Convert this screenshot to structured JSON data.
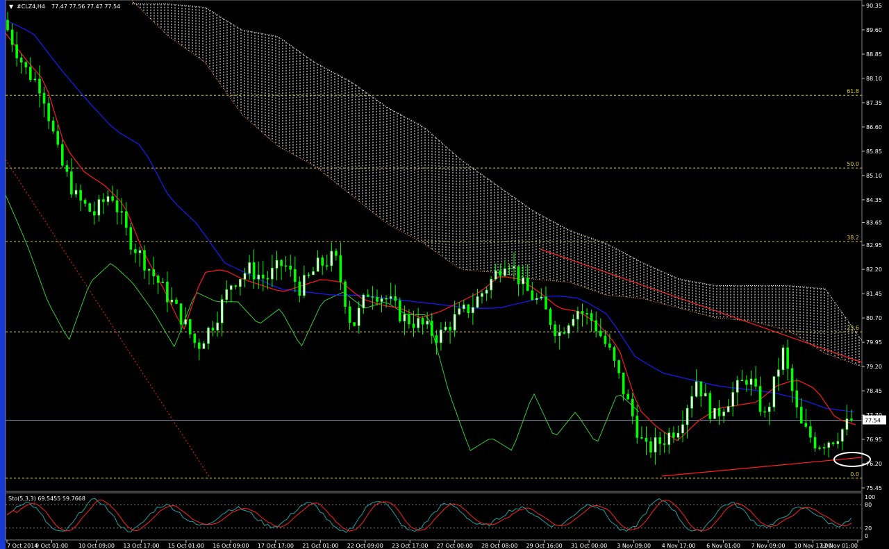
{
  "header": {
    "symbol": "#CLZ4,H4",
    "ohlc": "77.47 77.56 77.47 77.54"
  },
  "price_label": "77.54",
  "stochastic": {
    "label": "Sto(5,3,3) 69.5455 59.7668",
    "levels": [
      "100",
      "80",
      "20",
      "0"
    ]
  },
  "colors": {
    "background": "#000000",
    "bull_candle": "#ffffff",
    "bear_candle": "#00ff00",
    "tenkan": "#ff1a1a",
    "kijun": "#1a1aff",
    "chikou": "#33cc33",
    "cloud": "#ffffff",
    "fib": "#d8c830",
    "trendline": "#ff2020",
    "stoch_main": "#20a0a0",
    "stoch_signal": "#ff2020"
  },
  "chart_data": {
    "type": "candlestick",
    "symbol": "#CLZ4",
    "timeframe": "H4",
    "ylim": [
      75.45,
      90.35
    ],
    "y_ticks": [
      90.35,
      89.6,
      88.85,
      88.1,
      87.35,
      86.6,
      85.85,
      85.1,
      84.35,
      83.65,
      82.95,
      82.2,
      81.45,
      80.7,
      79.95,
      79.2,
      78.45,
      77.7,
      76.95,
      76.2,
      75.45
    ],
    "x_ticks": [
      "7 Oct 2014",
      "9 Oct 01:00",
      "10 Oct 09:00",
      "13 Oct 17:00",
      "15 Oct 01:00",
      "16 Oct 09:00",
      "17 Oct 17:00",
      "21 Oct 01:00",
      "22 Oct 09:00",
      "23 Oct 17:00",
      "27 Oct 00:00",
      "28 Oct 08:00",
      "29 Oct 16:00",
      "31 Oct 00:00",
      "3 Nov 09:00",
      "4 Nov 17:00",
      "6 Nov 01:00",
      "7 Nov 09:00",
      "10 Nov 17:00",
      "12 Nov 01:00"
    ],
    "fibonacci": [
      {
        "label": "61.8",
        "price": 87.58
      },
      {
        "label": "50.0",
        "price": 85.33
      },
      {
        "label": "38.2",
        "price": 83.06
      },
      {
        "label": "23.6",
        "price": 80.27
      },
      {
        "label": "0.0",
        "price": 75.75
      }
    ],
    "current_price": 77.54,
    "key_prices": [
      89.6,
      88.4,
      87.8,
      85.6,
      84.4,
      83.9,
      84.6,
      83.2,
      82.4,
      81.6,
      80.8,
      79.8,
      80.6,
      81.8,
      82.2,
      81.9,
      82.4,
      81.6,
      82.3,
      82.6,
      80.4,
      81.6,
      81.3,
      80.7,
      80.5,
      80.1,
      80.7,
      81.1,
      81.8,
      82.6,
      81.6,
      81.1,
      80.2,
      81.0,
      80.6,
      79.6,
      78.1,
      76.6,
      76.9,
      77.4,
      78.8,
      77.6,
      78.3,
      78.9,
      77.6,
      79.7,
      77.4,
      76.8,
      77.0,
      77.54
    ],
    "tenkan": [
      89.5,
      88.7,
      88.0,
      86.0,
      85.2,
      84.8,
      84.2,
      82.7,
      81.6,
      80.3,
      82.1,
      82.2,
      81.9,
      81.7,
      81.5,
      81.7,
      81.9,
      81.8,
      81.3,
      81.1,
      81.0,
      80.7,
      80.9,
      81.2,
      81.5,
      82.0,
      81.9,
      81.5,
      81.0,
      80.9,
      80.5,
      79.8,
      77.9,
      77.3,
      76.9,
      77.5,
      77.9,
      78.0,
      78.1,
      78.6,
      78.8,
      78.5,
      77.6,
      77.4
    ],
    "kijun": [
      89.9,
      89.5,
      88.4,
      87.4,
      86.5,
      86.0,
      84.4,
      83.6,
      82.4,
      82.0,
      81.6,
      81.5,
      81.4,
      81.4,
      81.3,
      81.2,
      81.1,
      81.0,
      81.0,
      81.2,
      81.4,
      81.3,
      80.8,
      79.5,
      79.0,
      78.8,
      78.6,
      78.5,
      78.4,
      78.2,
      77.9,
      77.8
    ],
    "chikou": [
      84.5,
      83.0,
      81.2,
      80.0,
      81.8,
      82.4,
      81.8,
      80.9,
      79.8,
      81.5,
      81.2,
      81.2,
      80.5,
      81.0,
      79.8,
      81.2,
      81.5,
      81.0,
      81.2,
      80.8,
      80.8,
      78.4,
      76.6,
      77.0,
      76.6,
      78.4,
      77.0,
      77.8,
      76.8,
      78.4,
      77.8
    ]
  }
}
